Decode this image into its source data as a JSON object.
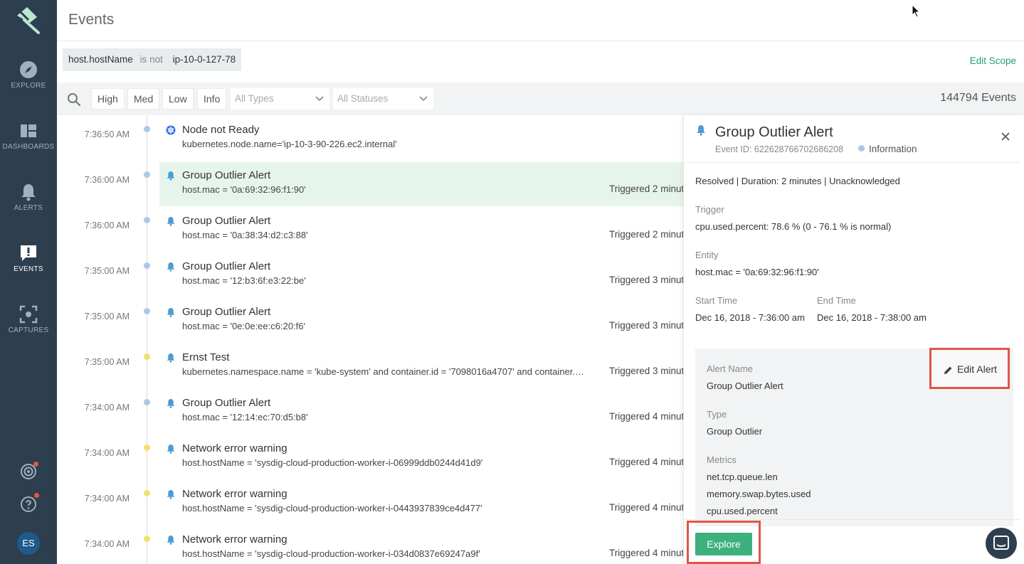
{
  "sidebar": {
    "items": [
      {
        "label": "EXPLORE",
        "icon": "compass-icon"
      },
      {
        "label": "DASHBOARDS",
        "icon": "dashboard-icon"
      },
      {
        "label": "ALERTS",
        "icon": "bell-icon"
      },
      {
        "label": "EVENTS",
        "icon": "exclamation-bubble-icon",
        "active": true
      },
      {
        "label": "CAPTURES",
        "icon": "capture-icon"
      }
    ],
    "user_initials": "ES"
  },
  "header": {
    "title": "Events"
  },
  "scope": {
    "field": "host.hostName",
    "operator": "is not",
    "value": "ip-10-0-127-78",
    "edit_label": "Edit Scope"
  },
  "filters": {
    "severities": [
      "High",
      "Med",
      "Low",
      "Info"
    ],
    "types_placeholder": "All Types",
    "statuses_placeholder": "All Statuses",
    "count": "144794 Events"
  },
  "events": [
    {
      "time": "7:36:50 AM",
      "title": "Node not Ready",
      "subtitle": "kubernetes.node.name='ip-10-3-90-226.ec2.internal'",
      "status": "",
      "dot": "#a9c8eb",
      "icon": "kubernetes-icon"
    },
    {
      "time": "7:36:00 AM",
      "title": "Group Outlier Alert",
      "subtitle": "host.mac = '0a:69:32:96:f1:90'",
      "status": "Triggered 2 minute",
      "dot": "#a9c8eb",
      "icon": "bell-icon",
      "selected": true
    },
    {
      "time": "7:36:00 AM",
      "title": "Group Outlier Alert",
      "subtitle": "host.mac = '0a:38:34:d2:c3:88'",
      "status": "Triggered 2 minute",
      "dot": "#a9c8eb",
      "icon": "bell-icon"
    },
    {
      "time": "7:35:00 AM",
      "title": "Group Outlier Alert",
      "subtitle": "host.mac = '12:b3:6f:e3:22:be'",
      "status": "Triggered 3 minute",
      "dot": "#a9c8eb",
      "icon": "bell-icon"
    },
    {
      "time": "7:35:00 AM",
      "title": "Group Outlier Alert",
      "subtitle": "host.mac = '0e:0e:ee:c6:20:f6'",
      "status": "Triggered 3 minute",
      "dot": "#a9c8eb",
      "icon": "bell-icon"
    },
    {
      "time": "7:35:00 AM",
      "title": "Ernst Test",
      "subtitle": "kubernetes.namespace.name = 'kube-system' and container.id = '7098016a4707' and container.im...",
      "status": "Triggered 3 minute",
      "dot": "#f3df6a",
      "icon": "bell-icon"
    },
    {
      "time": "7:34:00 AM",
      "title": "Group Outlier Alert",
      "subtitle": "host.mac = '12:14:ec:70:d5:b8'",
      "status": "Triggered 4 minute",
      "dot": "#a9c8eb",
      "icon": "bell-icon"
    },
    {
      "time": "7:34:00 AM",
      "title": "Network error warning",
      "subtitle": "host.hostName = 'sysdig-cloud-production-worker-i-06999ddb0244d41d9'",
      "status": "Triggered 4 minute",
      "dot": "#f3df6a",
      "icon": "bell-icon"
    },
    {
      "time": "7:34:00 AM",
      "title": "Network error warning",
      "subtitle": "host.hostName = 'sysdig-cloud-production-worker-i-0443937839ce4d477'",
      "status": "Triggered 4 minute",
      "dot": "#f3df6a",
      "icon": "bell-icon"
    },
    {
      "time": "7:34:00 AM",
      "title": "Network error warning",
      "subtitle": "host.hostName = 'sysdig-cloud-production-worker-i-034d0837e69247a9f'",
      "status": "Triggered 4 minute",
      "dot": "#f3df6a",
      "icon": "bell-icon"
    }
  ],
  "detail": {
    "title": "Group Outlier Alert",
    "event_id": "Event ID: 622628766702686208",
    "severity": "Information",
    "summary": "Resolved | Duration: 2 minutes | Unacknowledged",
    "trigger_label": "Trigger",
    "trigger_value": "cpu.used.percent: 78.6 % (0 - 76.1 % is normal)",
    "entity_label": "Entity",
    "entity_value": "host.mac = '0a:69:32:96:f1:90'",
    "start_label": "Start Time",
    "start_value": "Dec 16, 2018 - 7:36:00 am",
    "end_label": "End Time",
    "end_value": "Dec 16, 2018 - 7:38:00 am",
    "alert_name_label": "Alert Name",
    "alert_name_value": "Group Outlier Alert",
    "type_label": "Type",
    "type_value": "Group Outlier",
    "metrics_label": "Metrics",
    "metrics": [
      "net.tcp.queue.len",
      "memory.swap.bytes.used",
      "cpu.used.percent"
    ],
    "edit_alert_label": "Edit Alert",
    "explore_label": "Explore"
  },
  "colors": {
    "sidebar": "#2d3e4e",
    "accent": "#2a9d6f",
    "explore": "#3db07d",
    "highlight": "#e05545",
    "selected_row": "#e6f5ec"
  }
}
